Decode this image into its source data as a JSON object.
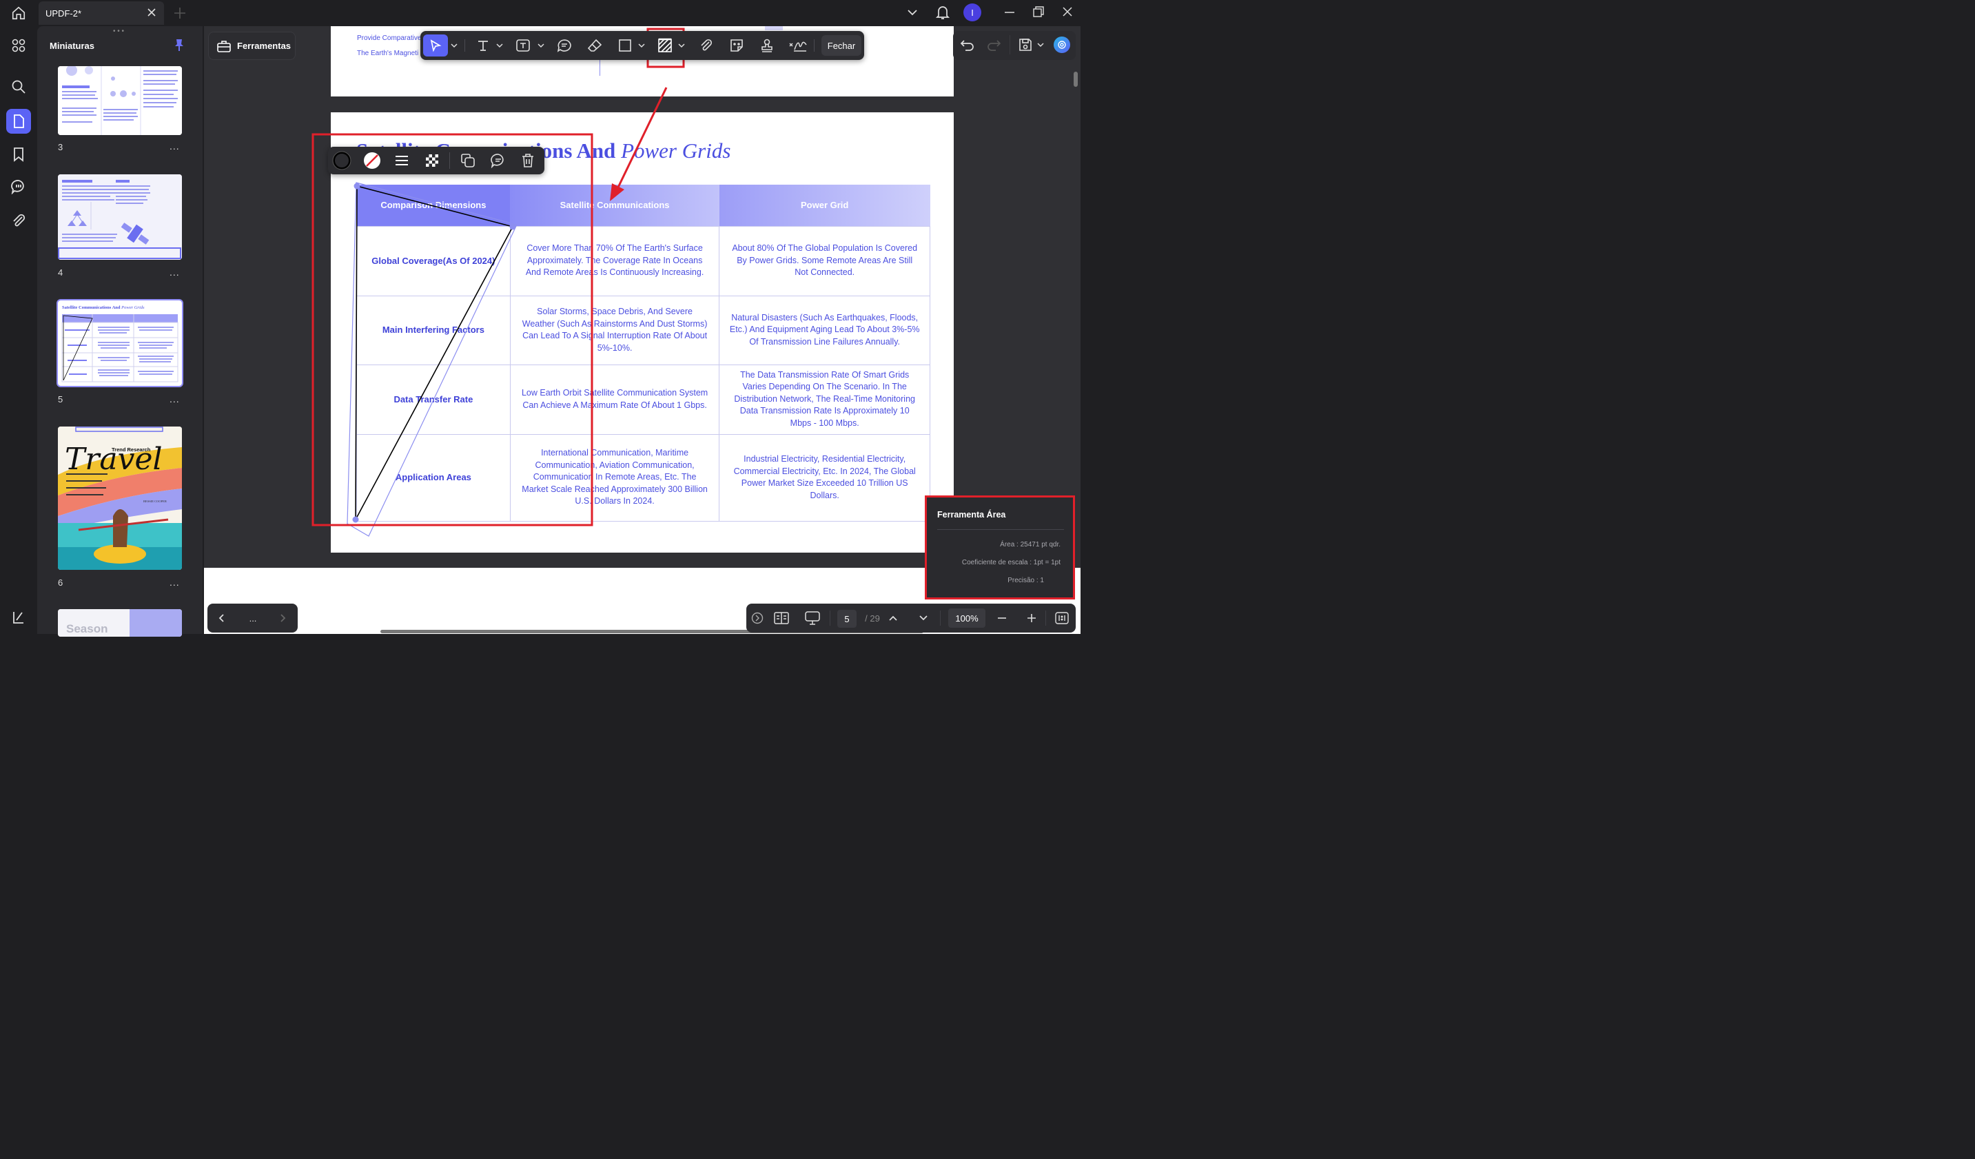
{
  "tab": {
    "title": "UPDF-2*"
  },
  "panel": {
    "title": "Miniaturas"
  },
  "thumbnails": [
    {
      "num": "3"
    },
    {
      "num": "4"
    },
    {
      "num": "5"
    },
    {
      "num": "6"
    }
  ],
  "thumb_text": {
    "title_5": "Satellite Communications And",
    "title_5_italic": "Power Grids",
    "travel": "Travel",
    "trend": "Trend Research",
    "author": "BESSIE COOPER",
    "season": "Season"
  },
  "more": "...",
  "toolbar": {
    "tools_label": "Ferramentas",
    "close_label": "Fechar"
  },
  "page_prev": {
    "line1": "Provide Comparative",
    "line2": "The Earth's Magneti"
  },
  "doc": {
    "title_visible": "ications And",
    "title_italic": "Power Grids",
    "title_hidden_prefix": "Satellite Comm",
    "headers": [
      "Comparison Dimensions",
      "Satellite Communications",
      "Power Grid"
    ],
    "rows": [
      {
        "label": "Global Coverage(As Of 2024)",
        "sat": "Cover More Than 70% Of The Earth's Surface Approximately. The Coverage Rate In Oceans And Remote Areas Is Continuously Increasing.",
        "grid": "About 80% Of The Global Population Is Covered By Power Grids. Some Remote Areas Are Still Not Connected."
      },
      {
        "label": "Main Interfering Factors",
        "sat": "Solar Storms, Space Debris, And Severe Weather (Such As Rainstorms And Dust Storms) Can Lead To A Signal Interruption Rate Of About 5%-10%.",
        "grid": "Natural Disasters (Such As Earthquakes, Floods, Etc.) And Equipment Aging Lead To About 3%-5% Of Transmission Line Failures Annually."
      },
      {
        "label": "Data Transfer Rate",
        "sat": "Low Earth Orbit Satellite Communication System Can Achieve A Maximum Rate Of About 1 Gbps.",
        "grid": "The Data Transmission Rate Of Smart Grids Varies Depending On The Scenario. In The Distribution Network, The Real-Time Monitoring Data Transmission Rate Is Approximately 10 Mbps - 100 Mbps."
      },
      {
        "label": "Application Areas",
        "sat": "International Communication, Maritime Communication, Aviation Communication, Communication In Remote Areas, Etc. The Market Scale Reached Approximately 300 Billion U.S. Dollars In 2024.",
        "grid": "Industrial Electricity, Residential Electricity, Commercial Electricity, Etc. In 2024, The Global Power Market Size Exceeded 10 Trillion US Dollars."
      }
    ]
  },
  "area_panel": {
    "title": "Ferramenta Área",
    "area": "Área : 25471  pt qdr.",
    "scale": "Coeficiente de escala : 1pt = 1pt",
    "precision": "Precisão : 1"
  },
  "nav": {
    "current_page": "5",
    "total_pages": "/ 29",
    "zoom": "100%",
    "more": "..."
  },
  "avatar": {
    "initial": "I"
  },
  "colors": {
    "accent": "#5b63f5",
    "highlight_red": "#e0202a",
    "table_text": "#4b4fe0",
    "header_start": "#7b7cf4",
    "header_end": "#c6c6fb"
  },
  "icons": [
    "home-icon",
    "close-icon",
    "plus-icon",
    "chevron-down-icon",
    "bell-icon",
    "minimize-icon",
    "restore-icon",
    "grid-icon",
    "search-icon",
    "pages-icon",
    "bookmark-icon",
    "comment-icon",
    "attachment-icon",
    "pin-icon",
    "toolbox-icon",
    "cursor-icon",
    "text-icon",
    "textbox-icon",
    "note-icon",
    "eraser-icon",
    "rectangle-icon",
    "area-measure-icon",
    "paperclip-icon",
    "sticker-icon",
    "stamp-icon",
    "signature-icon",
    "undo-icon",
    "redo-icon",
    "save-icon",
    "ai-icon"
  ]
}
